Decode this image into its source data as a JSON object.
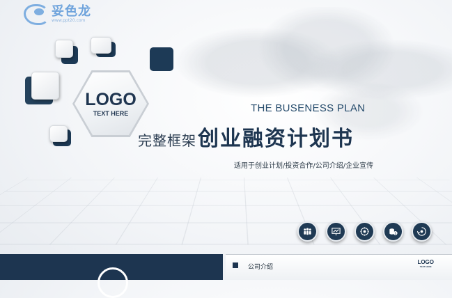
{
  "brand": {
    "name": "妥色龙",
    "url": "www.ppt20.com"
  },
  "logo": {
    "word": "LOGO",
    "sub": "TEXT HERE"
  },
  "title": {
    "english": "THE BUSENESS PLAN",
    "chinese_light": "完整框架",
    "chinese_bold": "创业融资计划书"
  },
  "subtitle": "适用于创业计划/投资合作/公司介绍/企业宣传",
  "icons": [
    "team-icon",
    "chart-board-icon",
    "gear-chat-icon",
    "coins-icon",
    "settings-cycle-icon"
  ],
  "bottom_panel": {
    "label": "公司介绍",
    "logo_word": "LOGO",
    "logo_sub": "TEXT HERE"
  },
  "colors": {
    "navy": "#1d3550",
    "accent_blue": "#244a6b",
    "brand_blue": "#6ea3dc"
  }
}
